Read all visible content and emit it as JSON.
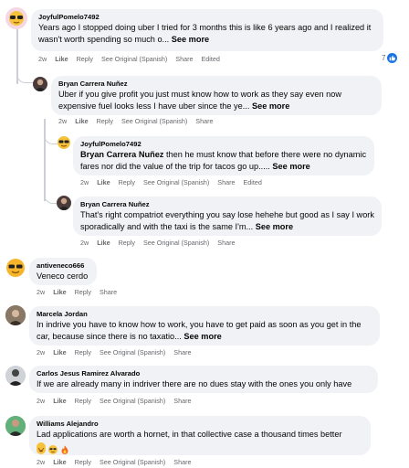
{
  "comments": [
    {
      "author": "JoyfulPomelo7492",
      "text": "Years ago I stopped doing uber I tried for 3 months this is like 6 years ago and I realized it wasn't worth spending so much o...",
      "see_more": "See more",
      "time": "2w",
      "like": "Like",
      "reply": "Reply",
      "see_original": "See Original (Spanish)",
      "share": "Share",
      "edited": "Edited",
      "reaction_count": "7"
    },
    {
      "author": "Bryan Carrera Nuñez",
      "text": "Uber if you give profit you just must know how to work as they say even now expensive fuel looks less I have uber since the ye...",
      "see_more": "See more",
      "time": "2w",
      "like": "Like",
      "reply": "Reply",
      "see_original": "See Original (Spanish)",
      "share": "Share"
    },
    {
      "author": "JoyfulPomelo7492",
      "mention": "Bryan Carrera Nuñez",
      "text": " then he must know that before there were no dynamic fares nor did the value of the trip for tacos go up.....",
      "see_more": "See more",
      "time": "2w",
      "like": "Like",
      "reply": "Reply",
      "see_original": "See Original (Spanish)",
      "share": "Share",
      "edited": "Edited"
    },
    {
      "author": "Bryan Carrera Nuñez",
      "text": "That's right compatriot everything you say lose hehehe but good as I say I work sporadically and with the taxi is the same I'm...",
      "see_more": "See more",
      "time": "2w",
      "like": "Like",
      "reply": "Reply",
      "see_original": "See Original (Spanish)",
      "share": "Share"
    },
    {
      "author": "antiveneco666",
      "text": "Veneco cerdo",
      "time": "2w",
      "like": "Like",
      "reply": "Reply",
      "share": "Share"
    },
    {
      "author": "Marcela Jordan",
      "text": "In indrive you have to know how to work, you have to get paid as soon as you get in the car, because since there is no taxatio...",
      "see_more": "See more",
      "time": "2w",
      "like": "Like",
      "reply": "Reply",
      "see_original": "See Original (Spanish)",
      "share": "Share"
    },
    {
      "author": "Carlos Jesus Ramirez Alvarado",
      "text": "If we are already many in indriver there are no dues stay with the ones you only have",
      "time": "2w",
      "like": "Like",
      "reply": "Reply",
      "see_original": "See Original (Spanish)",
      "share": "Share"
    },
    {
      "author": "Williams Alejandro",
      "text": "Lad applications are worth a hornet, in that collective case a thousand times better",
      "time": "2w",
      "like": "Like",
      "reply": "Reply",
      "see_original": "See Original (Spanish)",
      "share": "Share"
    }
  ],
  "colors": {
    "bubble": "#f0f2f5",
    "meta": "#65676b",
    "like_blue": "#1b74e4",
    "thread_line": "#ccd0d5"
  },
  "icons": [
    "sunglasses-emoji-avatar",
    "profile-photo-avatar",
    "like-reaction-icon",
    "laughing-emoji",
    "cool-emoji",
    "fire-emoji"
  ]
}
